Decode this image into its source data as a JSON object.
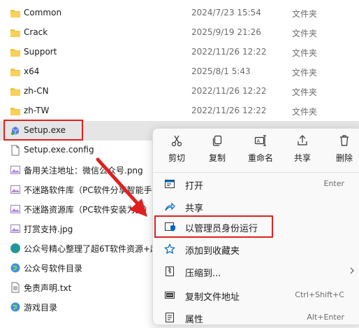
{
  "files": [
    {
      "name": "Common",
      "date": "2024/7/23 15:54",
      "type": "文件夹",
      "icon": "folder-icon"
    },
    {
      "name": "Crack",
      "date": "2025/9/19 21:26",
      "type": "文件夹",
      "icon": "folder-icon"
    },
    {
      "name": "Support",
      "date": "2022/11/26 12:22",
      "type": "文件夹",
      "icon": "folder-icon"
    },
    {
      "name": "x64",
      "date": "2025/8/1 5:43",
      "type": "文件夹",
      "icon": "folder-icon"
    },
    {
      "name": "zh-CN",
      "date": "2022/11/26 12:22",
      "type": "文件夹",
      "icon": "folder-icon"
    },
    {
      "name": "zh-TW",
      "date": "2022/11/26 12:22",
      "type": "文件夹",
      "icon": "folder-icon"
    },
    {
      "name": "Setup.exe",
      "date": "",
      "type": "",
      "icon": "installer-icon"
    },
    {
      "name": "Setup.exe.config",
      "date": "",
      "type": "",
      "icon": "file-icon"
    },
    {
      "name": "备用关注地址：微信公众号.png",
      "date": "",
      "type": "",
      "icon": "image-icon"
    },
    {
      "name": "不迷路软件库（PC软件分享智能手",
      "date": "",
      "type": "",
      "icon": "image-icon"
    },
    {
      "name": "不迷路资源库（PC软件安装为主）",
      "date": "",
      "type": "",
      "icon": "image-icon"
    },
    {
      "name": "打赏支持.jpg",
      "date": "",
      "type": "",
      "icon": "image-icon"
    },
    {
      "name": "公众号精心整理了超6T软件资源+超",
      "date": "",
      "type": "",
      "icon": "edge-icon"
    },
    {
      "name": "公众号软件目录",
      "date": "",
      "type": "",
      "icon": "globe-icon"
    },
    {
      "name": "免责声明.txt",
      "date": "",
      "type": "",
      "icon": "text-file-icon"
    },
    {
      "name": "游戏目录",
      "date": "",
      "type": "",
      "icon": "globe-icon"
    }
  ],
  "selected_file_index": 6,
  "context_menu": {
    "quick_actions": [
      {
        "label": "剪切",
        "icon": "scissors-icon"
      },
      {
        "label": "复制",
        "icon": "copy-icon"
      },
      {
        "label": "重命名",
        "icon": "rename-icon"
      },
      {
        "label": "共享",
        "icon": "share-icon"
      },
      {
        "label": "删除",
        "icon": "trash-icon"
      }
    ],
    "items": [
      {
        "label": "打开",
        "shortcut": "Enter",
        "icon": "open-icon"
      },
      {
        "label": "共享",
        "shortcut": "",
        "icon": "share-icon"
      },
      {
        "label": "以管理员身份运行",
        "shortcut": "",
        "icon": "shield-icon"
      },
      {
        "label": "添加到收藏夹",
        "shortcut": "",
        "icon": "star-icon"
      },
      {
        "label": "压缩到...",
        "shortcut": "",
        "icon": "zip-icon"
      },
      {
        "label": "复制文件地址",
        "shortcut": "Ctrl+Shift+C",
        "icon": "path-icon"
      },
      {
        "label": "属性",
        "shortcut": "Alt+Enter",
        "icon": "properties-icon"
      }
    ]
  },
  "colors": {
    "folder": "#f4c33a",
    "accent": "#0067c0",
    "highlight_border": "#e02020",
    "selection": "#e5e5e5"
  }
}
